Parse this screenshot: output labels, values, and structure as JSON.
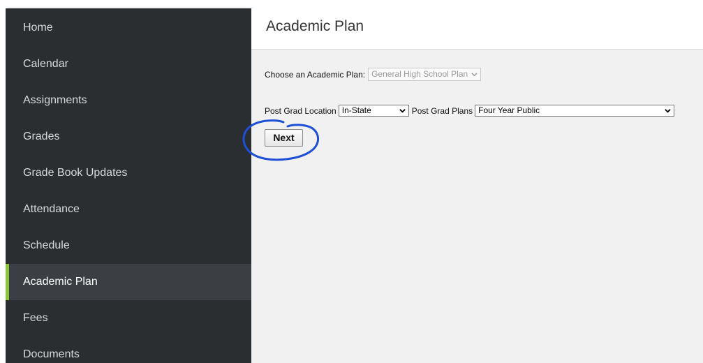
{
  "sidebar": {
    "items": [
      {
        "label": "Home"
      },
      {
        "label": "Calendar"
      },
      {
        "label": "Assignments"
      },
      {
        "label": "Grades"
      },
      {
        "label": "Grade Book Updates"
      },
      {
        "label": "Attendance"
      },
      {
        "label": "Schedule"
      },
      {
        "label": "Academic Plan",
        "active": true
      },
      {
        "label": "Fees"
      },
      {
        "label": "Documents"
      }
    ],
    "active_accent_color": "#8cc63f"
  },
  "main": {
    "title": "Academic Plan",
    "plan_selector": {
      "label": "Choose an Academic Plan:",
      "value": "General High School Plan",
      "disabled": true
    },
    "location_selector": {
      "label": "Post Grad Location",
      "value": "In-State"
    },
    "plans_selector": {
      "label": "Post Grad Plans",
      "value": "Four Year Public"
    },
    "next_button": {
      "label": "Next"
    }
  },
  "annotation": {
    "shape": "hand-drawn circle around Next button",
    "color": "#1f4fd6"
  }
}
